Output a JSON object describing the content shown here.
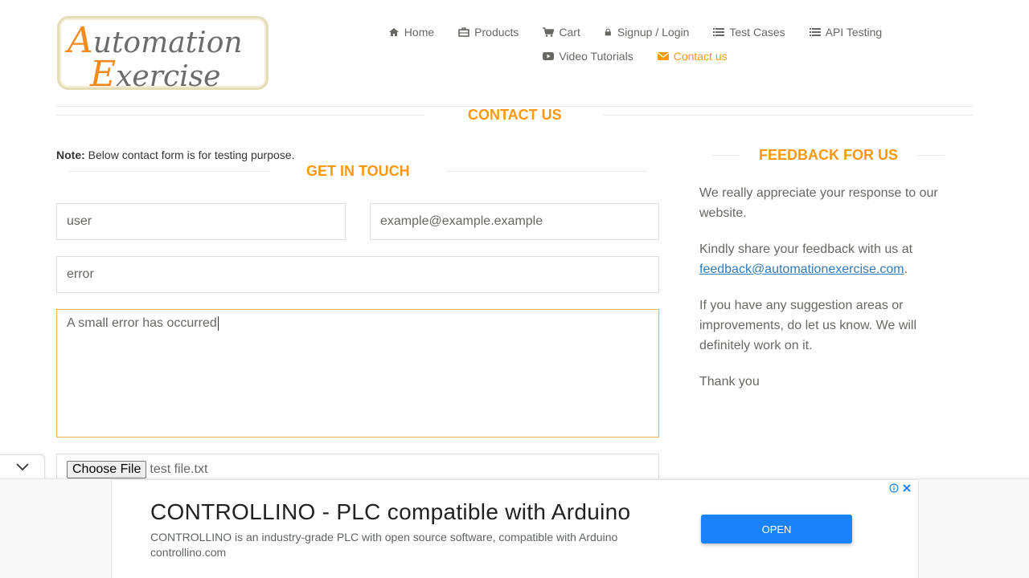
{
  "header": {
    "logo": {
      "line1_cap": "A",
      "line1_rest": "utomation",
      "line2_cap": "E",
      "line2_rest": "xercise"
    },
    "nav_row1": [
      {
        "label": "Home",
        "icon": "home-icon"
      },
      {
        "label": "Products",
        "icon": "briefcase-icon"
      },
      {
        "label": "Cart",
        "icon": "cart-icon"
      },
      {
        "label": "Signup / Login",
        "icon": "lock-icon"
      },
      {
        "label": "Test Cases",
        "icon": "list-icon"
      },
      {
        "label": "API Testing",
        "icon": "list-icon"
      }
    ],
    "nav_row2": [
      {
        "label": "Video Tutorials",
        "icon": "youtube-icon"
      },
      {
        "label": "Contact us",
        "icon": "envelope-icon",
        "active": true
      }
    ]
  },
  "contact": {
    "title": "Contact Us",
    "note_label": "Note:",
    "note_text": " Below contact form is for testing purpose.",
    "get_in_touch": "Get In Touch",
    "name_value": "user",
    "email_value": "example@example.example",
    "subject_value": "error",
    "message_value": "A small error has occurred",
    "file_button": "Choose File",
    "file_name": "test  file.txt"
  },
  "feedback": {
    "title": "Feedback For Us",
    "p1": "We really appreciate your response to our website.",
    "p2_text": "Kindly share your feedback with us at ",
    "p2_link": "feedback@automationexercise.com",
    "p2_end": ".",
    "p3": "If you have any suggestion areas or improvements, do let us know. We will definitely work on it.",
    "p4": "Thank you"
  },
  "ad": {
    "title": "CONTROLLINO - PLC compatible with Arduino",
    "description": "CONTROLLINO is an industry-grade PLC with open source software, compatible with Arduino",
    "domain": "controllino.com",
    "button": "OPEN"
  },
  "colors": {
    "accent": "#fe980f",
    "link": "#337ab7",
    "ad_button": "#1a82fb"
  }
}
